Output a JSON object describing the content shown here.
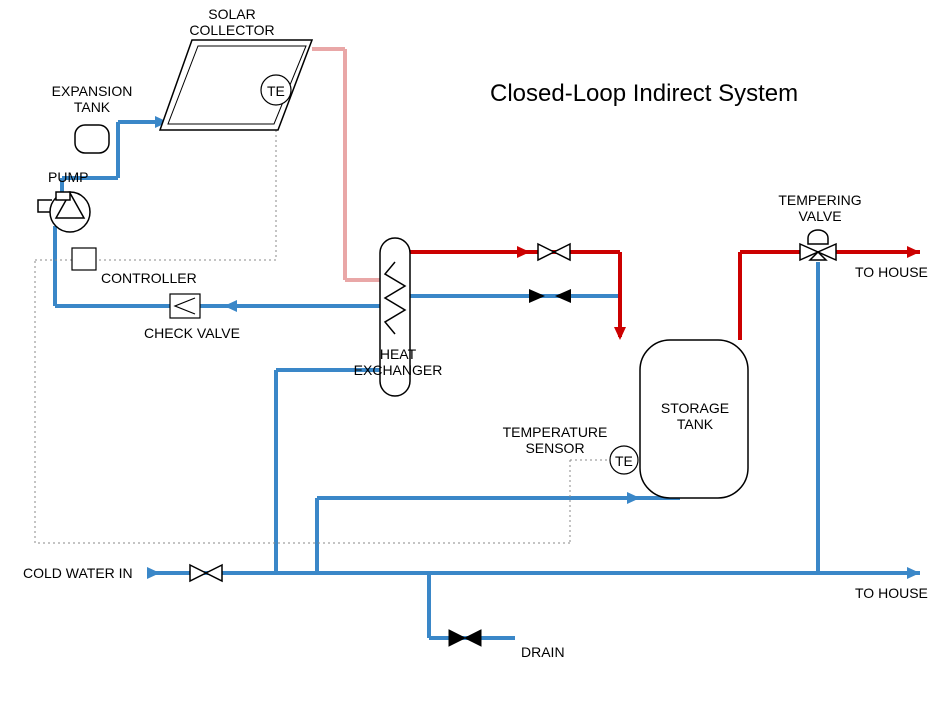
{
  "title": "Closed-Loop Indirect System",
  "labels": {
    "solar_collector": "SOLAR\nCOLLECTOR",
    "te": "TE",
    "expansion_tank": "EXPANSION\nTANK",
    "pump": "PUMP",
    "controller": "CONTROLLER",
    "check_valve": "CHECK VALVE",
    "heat_exchanger": "HEAT\nEXCHANGER",
    "temperature_sensor": "TEMPERATURE\nSENSOR",
    "storage_tank": "STORAGE\nTANK",
    "tempering_valve": "TEMPERING\nVALVE",
    "cold_water_in": "COLD WATER IN",
    "drain": "DRAIN",
    "to_house": "TO HOUSE",
    "to_house2": "TO HOUSE"
  },
  "colors": {
    "cold": "#3a87c8",
    "hot": "#cc0000",
    "warm": "#e9a7a7",
    "outline": "#000000",
    "dashed": "#888888"
  }
}
